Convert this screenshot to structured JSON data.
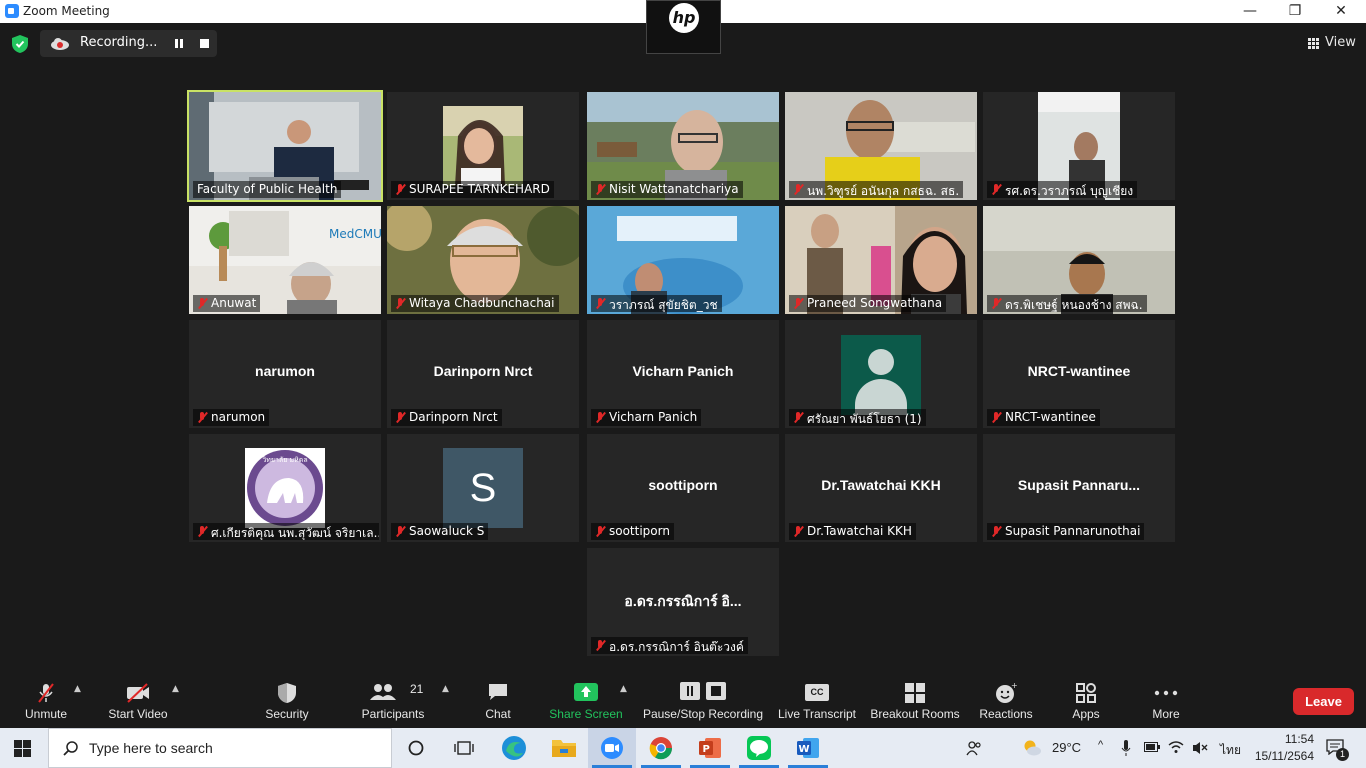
{
  "window": {
    "title": "Zoom Meeting",
    "controls": {
      "minimize": "—",
      "maximize": "❐",
      "close": "✕"
    }
  },
  "brand": {
    "logo": "hp"
  },
  "topbar": {
    "recording_label": "Recording...",
    "view_label": "View"
  },
  "colors": {
    "active_speaker": "#c9e265",
    "muted_mic": "#e02828",
    "share_green": "#22c35d",
    "leave_red": "#d9292b",
    "taskbar": "#e6ebf3"
  },
  "participants": [
    {
      "name": "Faculty of Public Health",
      "display": "",
      "muted": false,
      "kind": "video",
      "active": true
    },
    {
      "name": "SURAPEE TARNKEHARD",
      "display": "",
      "muted": true,
      "kind": "photo"
    },
    {
      "name": "Nisit Wattanatchariya",
      "display": "",
      "muted": true,
      "kind": "video"
    },
    {
      "name": "นพ.วิฑูรย์ อนันกุล กสธฉ. สธ.",
      "display": "",
      "muted": true,
      "kind": "video"
    },
    {
      "name": "รศ.ดร.วราภรณ์ บุญเชียง",
      "display": "",
      "muted": true,
      "kind": "video"
    },
    {
      "name": "Anuwat",
      "display": "",
      "muted": true,
      "kind": "video"
    },
    {
      "name": "Witaya Chadbunchachai",
      "display": "",
      "muted": true,
      "kind": "video"
    },
    {
      "name": "วราภรณ์ สุขัยชิต_วช",
      "display": "",
      "muted": true,
      "kind": "video"
    },
    {
      "name": "Praneed Songwathana",
      "display": "",
      "muted": true,
      "kind": "video"
    },
    {
      "name": "ดร.พิเชษฐ์ หนองช้าง สพฉ.",
      "display": "",
      "muted": true,
      "kind": "video"
    },
    {
      "name": "narumon",
      "display": "narumon",
      "muted": true,
      "kind": "name"
    },
    {
      "name": "Darinporn Nrct",
      "display": "Darinporn Nrct",
      "muted": true,
      "kind": "name"
    },
    {
      "name": "Vicharn Panich",
      "display": "Vicharn Panich",
      "muted": true,
      "kind": "name"
    },
    {
      "name": "ศรัณยา พันธ์โยธา (1)",
      "display": "",
      "muted": true,
      "kind": "avatar"
    },
    {
      "name": "NRCT-wantinee",
      "display": "NRCT-wantinee",
      "muted": true,
      "kind": "name"
    },
    {
      "name": "ศ.เกียรติคุณ นพ.สุวัฒน์ จริยาเล...",
      "display": "",
      "muted": true,
      "kind": "logo",
      "logo_text": "วิทยาลัย มหิดล"
    },
    {
      "name": "Saowaluck S",
      "display": "",
      "muted": true,
      "kind": "letter",
      "letter": "S"
    },
    {
      "name": "soottiporn",
      "display": "soottiporn",
      "muted": true,
      "kind": "name"
    },
    {
      "name": "Dr.Tawatchai KKH",
      "display": "Dr.Tawatchai KKH",
      "muted": true,
      "kind": "name"
    },
    {
      "name": "Supasit Pannarunothai",
      "display": "Supasit  Pannaru...",
      "muted": true,
      "kind": "name"
    },
    {
      "name": "อ.ดร.กรรณิการ์ อินต๊ะวงค์",
      "display": "อ.ดร.กรรณิการ์ อิ...",
      "muted": true,
      "kind": "name"
    }
  ],
  "toolbar": {
    "unmute": "Unmute",
    "start_video": "Start Video",
    "security": "Security",
    "participants": "Participants",
    "participants_count": "21",
    "chat": "Chat",
    "share_screen": "Share Screen",
    "pause_stop_recording": "Pause/Stop Recording",
    "live_transcript": "Live Transcript",
    "live_transcript_badge": "CC",
    "breakout_rooms": "Breakout Rooms",
    "reactions": "Reactions",
    "apps": "Apps",
    "more": "More",
    "leave": "Leave"
  },
  "taskbar": {
    "search_placeholder": "Type here to search",
    "weather": "29°C",
    "language": "ไทย",
    "time": "11:54",
    "date": "15/11/2564",
    "notifications": "1",
    "apps": [
      "task-view",
      "edge",
      "file-explorer",
      "zoom",
      "chrome",
      "powerpoint",
      "line",
      "word"
    ]
  }
}
